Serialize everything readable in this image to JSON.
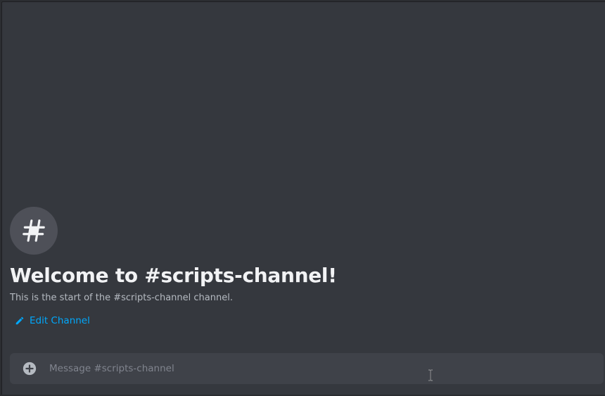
{
  "welcome": {
    "title": "Welcome to #scripts-channel!",
    "subtitle": "This is the start of the #scripts-channel channel.",
    "edit_label": "Edit Channel",
    "avatar_icon": "hashtag-icon"
  },
  "composer": {
    "placeholder": "Message #scripts-channel",
    "value": "",
    "attach_icon": "plus-circle-icon"
  },
  "colors": {
    "background": "#35383e",
    "link": "#00a8fc",
    "title": "#f2f3f5"
  }
}
